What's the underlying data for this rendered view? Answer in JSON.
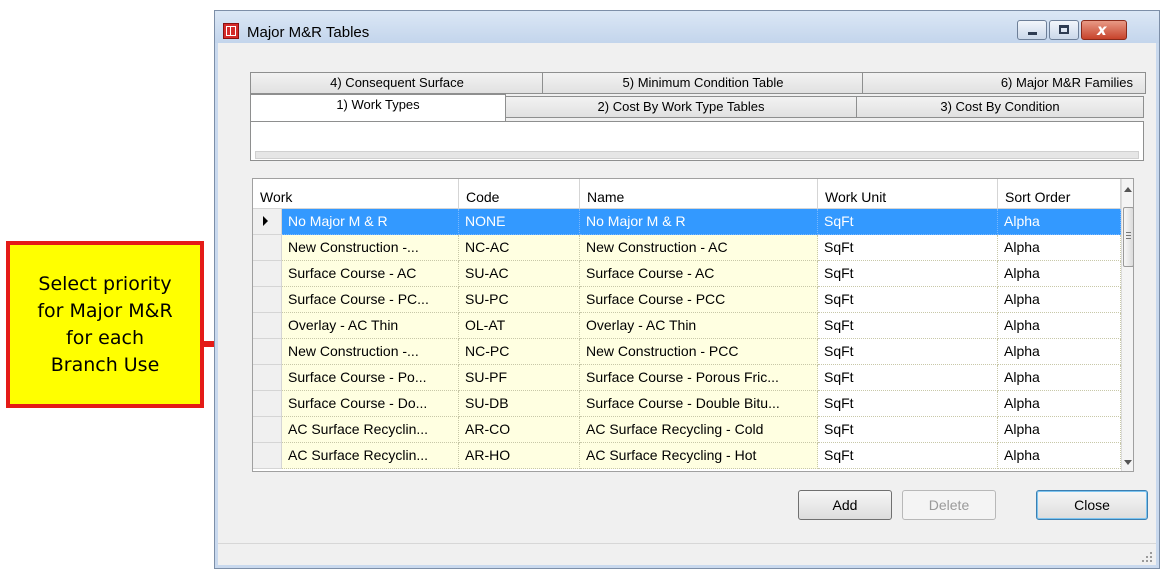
{
  "callout": {
    "lines": [
      "Select priority",
      "for Major M&R",
      "for each",
      "Branch Use"
    ]
  },
  "window": {
    "title": "Major M&R Tables",
    "close_glyph": "x"
  },
  "tabs": {
    "row_back": [
      "4) Consequent Surface",
      "5) Minimum Condition Table",
      "6) Major M&R Families"
    ],
    "row_front": [
      "1) Work Types",
      "2) Cost By Work Type Tables",
      "3) Cost By Condition"
    ],
    "active": "1) Work Types"
  },
  "grid": {
    "columns": [
      "Work",
      "Code",
      "Name",
      "Work Unit",
      "Sort Order"
    ],
    "rows": [
      [
        "No Major M & R",
        "NONE",
        "No Major M & R",
        "SqFt",
        "Alpha"
      ],
      [
        "New Construction -...",
        "NC-AC",
        "New Construction - AC",
        "SqFt",
        "Alpha"
      ],
      [
        "Surface Course - AC",
        "SU-AC",
        "Surface Course - AC",
        "SqFt",
        "Alpha"
      ],
      [
        "Surface Course - PC...",
        "SU-PC",
        "Surface Course - PCC",
        "SqFt",
        "Alpha"
      ],
      [
        "Overlay - AC Thin",
        "OL-AT",
        "Overlay - AC Thin",
        "SqFt",
        "Alpha"
      ],
      [
        "New Construction -...",
        "NC-PC",
        "New Construction - PCC",
        "SqFt",
        "Alpha"
      ],
      [
        "Surface Course - Po...",
        "SU-PF",
        "Surface Course - Porous Fric...",
        "SqFt",
        "Alpha"
      ],
      [
        "Surface Course - Do...",
        "SU-DB",
        "Surface Course - Double Bitu...",
        "SqFt",
        "Alpha"
      ],
      [
        "AC Surface Recyclin...",
        "AR-CO",
        "AC Surface Recycling - Cold",
        "SqFt",
        "Alpha"
      ],
      [
        "AC Surface Recyclin...",
        "AR-HO",
        "AC Surface Recycling - Hot",
        "SqFt",
        "Alpha"
      ]
    ],
    "selected_row": 0
  },
  "buttons": {
    "add": "Add",
    "delete": "Delete",
    "close": "Close"
  },
  "colors": {
    "callout_fill": "#ffff00",
    "callout_border": "#e41b17",
    "selection": "#3399ff",
    "cell_tint": "#ffffe1"
  }
}
